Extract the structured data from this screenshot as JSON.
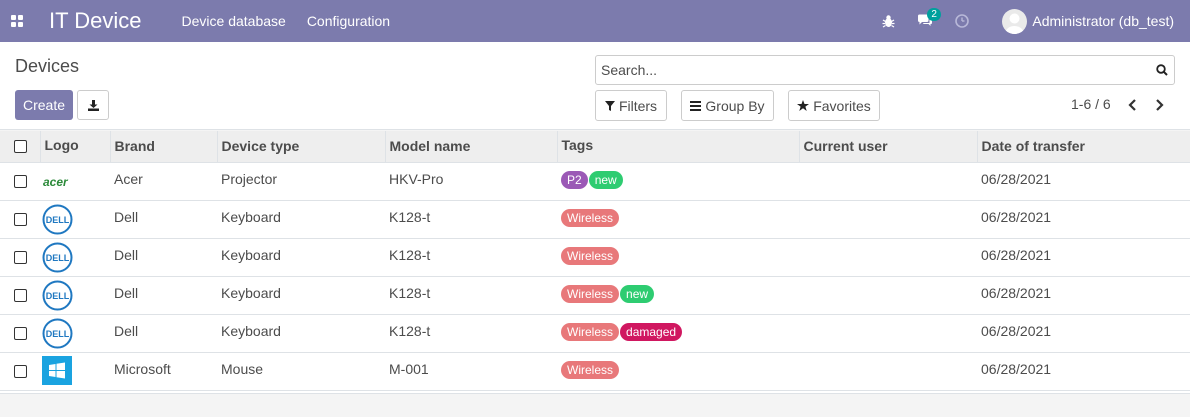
{
  "navbar": {
    "app_title": "IT Device",
    "menus": [
      "Device database",
      "Configuration"
    ],
    "message_count": "2",
    "user": "Administrator (db_test)"
  },
  "control_panel": {
    "breadcrumb": "Devices",
    "create_label": "Create",
    "search_placeholder": "Search...",
    "filters_label": "Filters",
    "group_by_label": "Group By",
    "favorites_label": "Favorites",
    "pager": "1-6 / 6"
  },
  "table": {
    "columns": [
      "Logo",
      "Brand",
      "Device type",
      "Model name",
      "Tags",
      "Current user",
      "Date of transfer"
    ],
    "rows": [
      {
        "logo": "acer-logo",
        "brand": "Acer",
        "device_type": "Projector",
        "model": "HKV-Pro",
        "tags": [
          {
            "label": "P2",
            "color": "#9b59b6"
          },
          {
            "label": "new",
            "color": "#2ecc71"
          }
        ],
        "current_user": "",
        "date": "06/28/2021"
      },
      {
        "logo": "dell-logo",
        "brand": "Dell",
        "device_type": "Keyboard",
        "model": "K128-t",
        "tags": [
          {
            "label": "Wireless",
            "color": "#e8787a"
          }
        ],
        "current_user": "",
        "date": "06/28/2021"
      },
      {
        "logo": "dell-logo",
        "brand": "Dell",
        "device_type": "Keyboard",
        "model": "K128-t",
        "tags": [
          {
            "label": "Wireless",
            "color": "#e8787a"
          }
        ],
        "current_user": "",
        "date": "06/28/2021"
      },
      {
        "logo": "dell-logo",
        "brand": "Dell",
        "device_type": "Keyboard",
        "model": "K128-t",
        "tags": [
          {
            "label": "Wireless",
            "color": "#e8787a"
          },
          {
            "label": "new",
            "color": "#2ecc71"
          }
        ],
        "current_user": "",
        "date": "06/28/2021"
      },
      {
        "logo": "dell-logo",
        "brand": "Dell",
        "device_type": "Keyboard",
        "model": "K128-t",
        "tags": [
          {
            "label": "Wireless",
            "color": "#e8787a"
          },
          {
            "label": "damaged",
            "color": "#d01760"
          }
        ],
        "current_user": "",
        "date": "06/28/2021"
      },
      {
        "logo": "windows-logo",
        "brand": "Microsoft",
        "device_type": "Mouse",
        "model": "M-001",
        "tags": [
          {
            "label": "Wireless",
            "color": "#e8787a"
          }
        ],
        "current_user": "",
        "date": "06/28/2021"
      }
    ]
  },
  "colors": {
    "brand": "#7c7bad",
    "accent_badge": "#00a09d"
  },
  "logo_text": {
    "acer": "acer",
    "dell": "DELL"
  }
}
